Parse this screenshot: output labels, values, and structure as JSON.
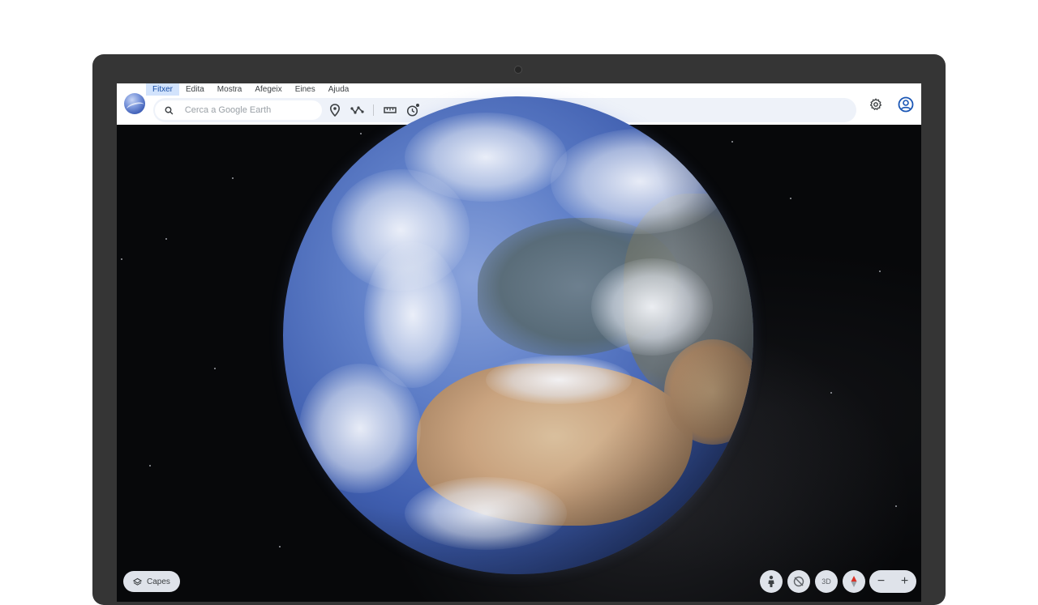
{
  "menu": {
    "items": [
      {
        "label": "Fitxer",
        "active": true
      },
      {
        "label": "Edita",
        "active": false
      },
      {
        "label": "Mostra",
        "active": false
      },
      {
        "label": "Afegeix",
        "active": false
      },
      {
        "label": "Eines",
        "active": false
      },
      {
        "label": "Ajuda",
        "active": false
      }
    ]
  },
  "search": {
    "placeholder": "Cerca a Google Earth",
    "value": ""
  },
  "toolbar": {
    "icons": [
      "placemark-icon",
      "path-icon",
      "ruler-icon",
      "history-icon",
      "chevron-up-icon"
    ]
  },
  "topright": {
    "icons": [
      "settings-icon",
      "account-icon"
    ]
  },
  "bottom": {
    "layers_label": "Capes",
    "view_3d_label": "3D",
    "zoom_out_label": "−",
    "zoom_in_label": "+"
  },
  "colors": {
    "accent": "#174ea6",
    "menu_active_bg": "#d2e3fc",
    "toolbar_bg": "#eef2f9",
    "device_frame": "#353535"
  }
}
